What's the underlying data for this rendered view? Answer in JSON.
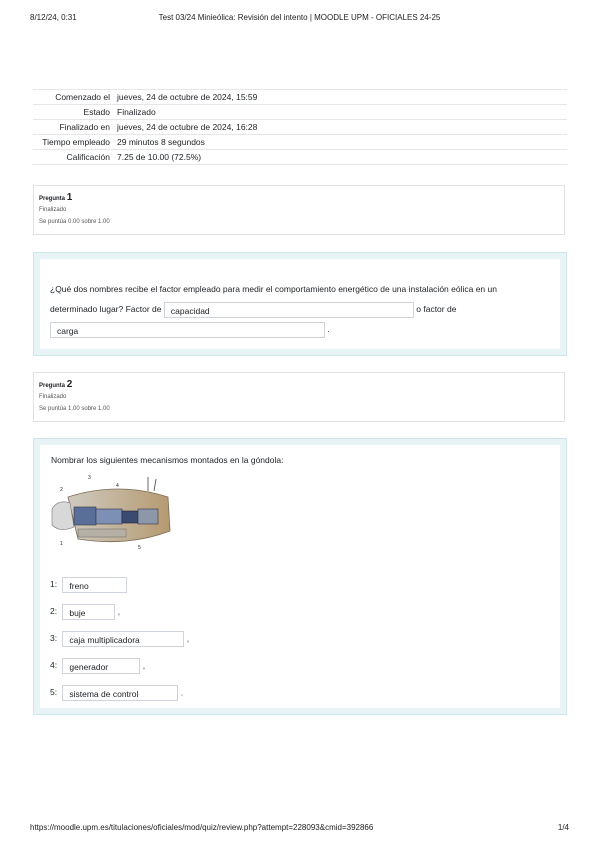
{
  "print_header": {
    "date": "8/12/24, 0:31",
    "title": "Test 03/24 Minieólica: Revisión del intento | MOODLE UPM - OFICIALES 24-25"
  },
  "summary": [
    {
      "label": "Comenzado el",
      "value": "jueves, 24 de octubre de 2024, 15:59"
    },
    {
      "label": "Estado",
      "value": "Finalizado"
    },
    {
      "label": "Finalizado en",
      "value": "jueves, 24 de octubre de 2024, 16:28"
    },
    {
      "label": "Tiempo empleado",
      "value": "29 minutos 8 segundos"
    },
    {
      "label": "Calificación",
      "value": "7.25 de 10.00 (72.5%)"
    }
  ],
  "questions": [
    {
      "prefix": "Pregunta",
      "number": "1",
      "state": "Finalizado",
      "grade": "Se puntúa 0.00 sobre 1.00",
      "text_part1": "¿Qué dos nombres recibe el factor empleado para medir el comportamiento energético de una instalación eólica en un determinado lugar? Factor de",
      "answer1": "capacidad",
      "text_part2": "o factor de",
      "answer2": "carga",
      "text_end": "."
    },
    {
      "prefix": "Pregunta",
      "number": "2",
      "state": "Finalizado",
      "grade": "Se puntúa 1.00 sobre 1.00",
      "text": "Nombrar los siguientes mecanismos montados en la góndola:",
      "diagram_labels": [
        "1",
        "2",
        "3",
        "4",
        "5"
      ],
      "answers": [
        {
          "num": "1:",
          "value": "freno",
          "suffix": ""
        },
        {
          "num": "2:",
          "value": "buje",
          "suffix": ","
        },
        {
          "num": "3:",
          "value": "caja multiplicadora",
          "suffix": ","
        },
        {
          "num": "4:",
          "value": "generador",
          "suffix": ","
        },
        {
          "num": "5:",
          "value": "sistema de control",
          "suffix": "."
        }
      ]
    }
  ],
  "print_footer": {
    "url": "https://moodle.upm.es/titulaciones/oficiales/mod/quiz/review.php?attempt=228093&cmid=392866",
    "page": "1/4"
  }
}
